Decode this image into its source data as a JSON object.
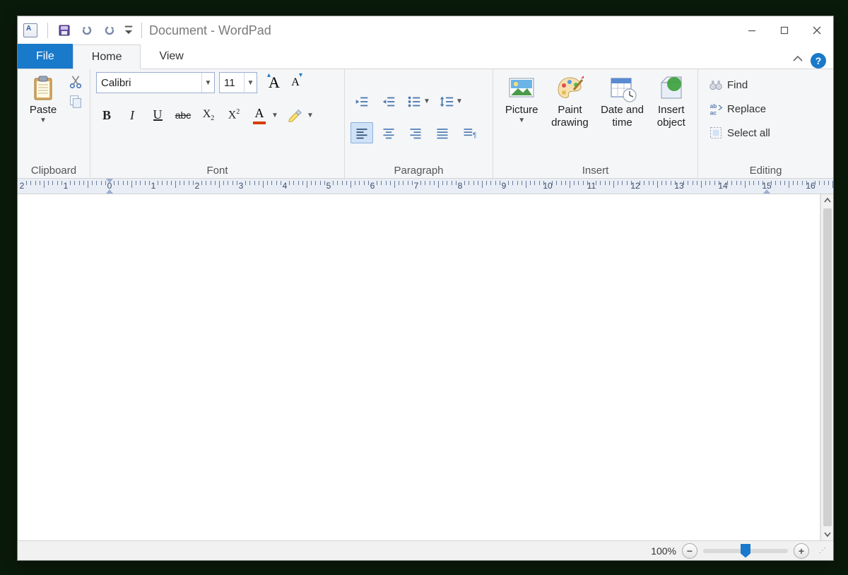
{
  "title": "Document - WordPad",
  "qat": {
    "save": "Save",
    "undo": "Undo",
    "redo": "Redo",
    "customize": "Customize Quick Access Toolbar"
  },
  "windowControls": {
    "minimize": "Minimize",
    "maximize": "Maximize",
    "close": "Close"
  },
  "tabs": {
    "file": "File",
    "home": "Home",
    "view": "View",
    "help": "?"
  },
  "ribbon": {
    "clipboard": {
      "group": "Clipboard",
      "paste": "Paste",
      "cut": "Cut",
      "copy": "Copy"
    },
    "font": {
      "group": "Font",
      "fontName": "Calibri",
      "fontSize": "11",
      "grow": "Grow font",
      "shrink": "Shrink font",
      "bold": "B",
      "italic": "I",
      "underline": "U",
      "strike": "abc",
      "subscript": "X",
      "superscript": "X",
      "fontColor": "A",
      "highlight": "Highlight"
    },
    "paragraph": {
      "group": "Paragraph",
      "decIndent": "Decrease indent",
      "incIndent": "Increase indent",
      "bullets": "Bullets",
      "lineSpacing": "Line spacing",
      "alignLeft": "Align left",
      "alignCenter": "Center",
      "alignRight": "Align right",
      "justify": "Justify",
      "paragraphDlg": "Paragraph"
    },
    "insert": {
      "group": "Insert",
      "picture": "Picture",
      "paint": "Paint\ndrawing",
      "datetime": "Date and\ntime",
      "object": "Insert\nobject"
    },
    "editing": {
      "group": "Editing",
      "find": "Find",
      "replace": "Replace",
      "selectAll": "Select all"
    }
  },
  "ruler": {
    "start": -2,
    "end": 17,
    "pxPerCm": 62,
    "origin": 130
  },
  "statusbar": {
    "zoom": "100%"
  }
}
